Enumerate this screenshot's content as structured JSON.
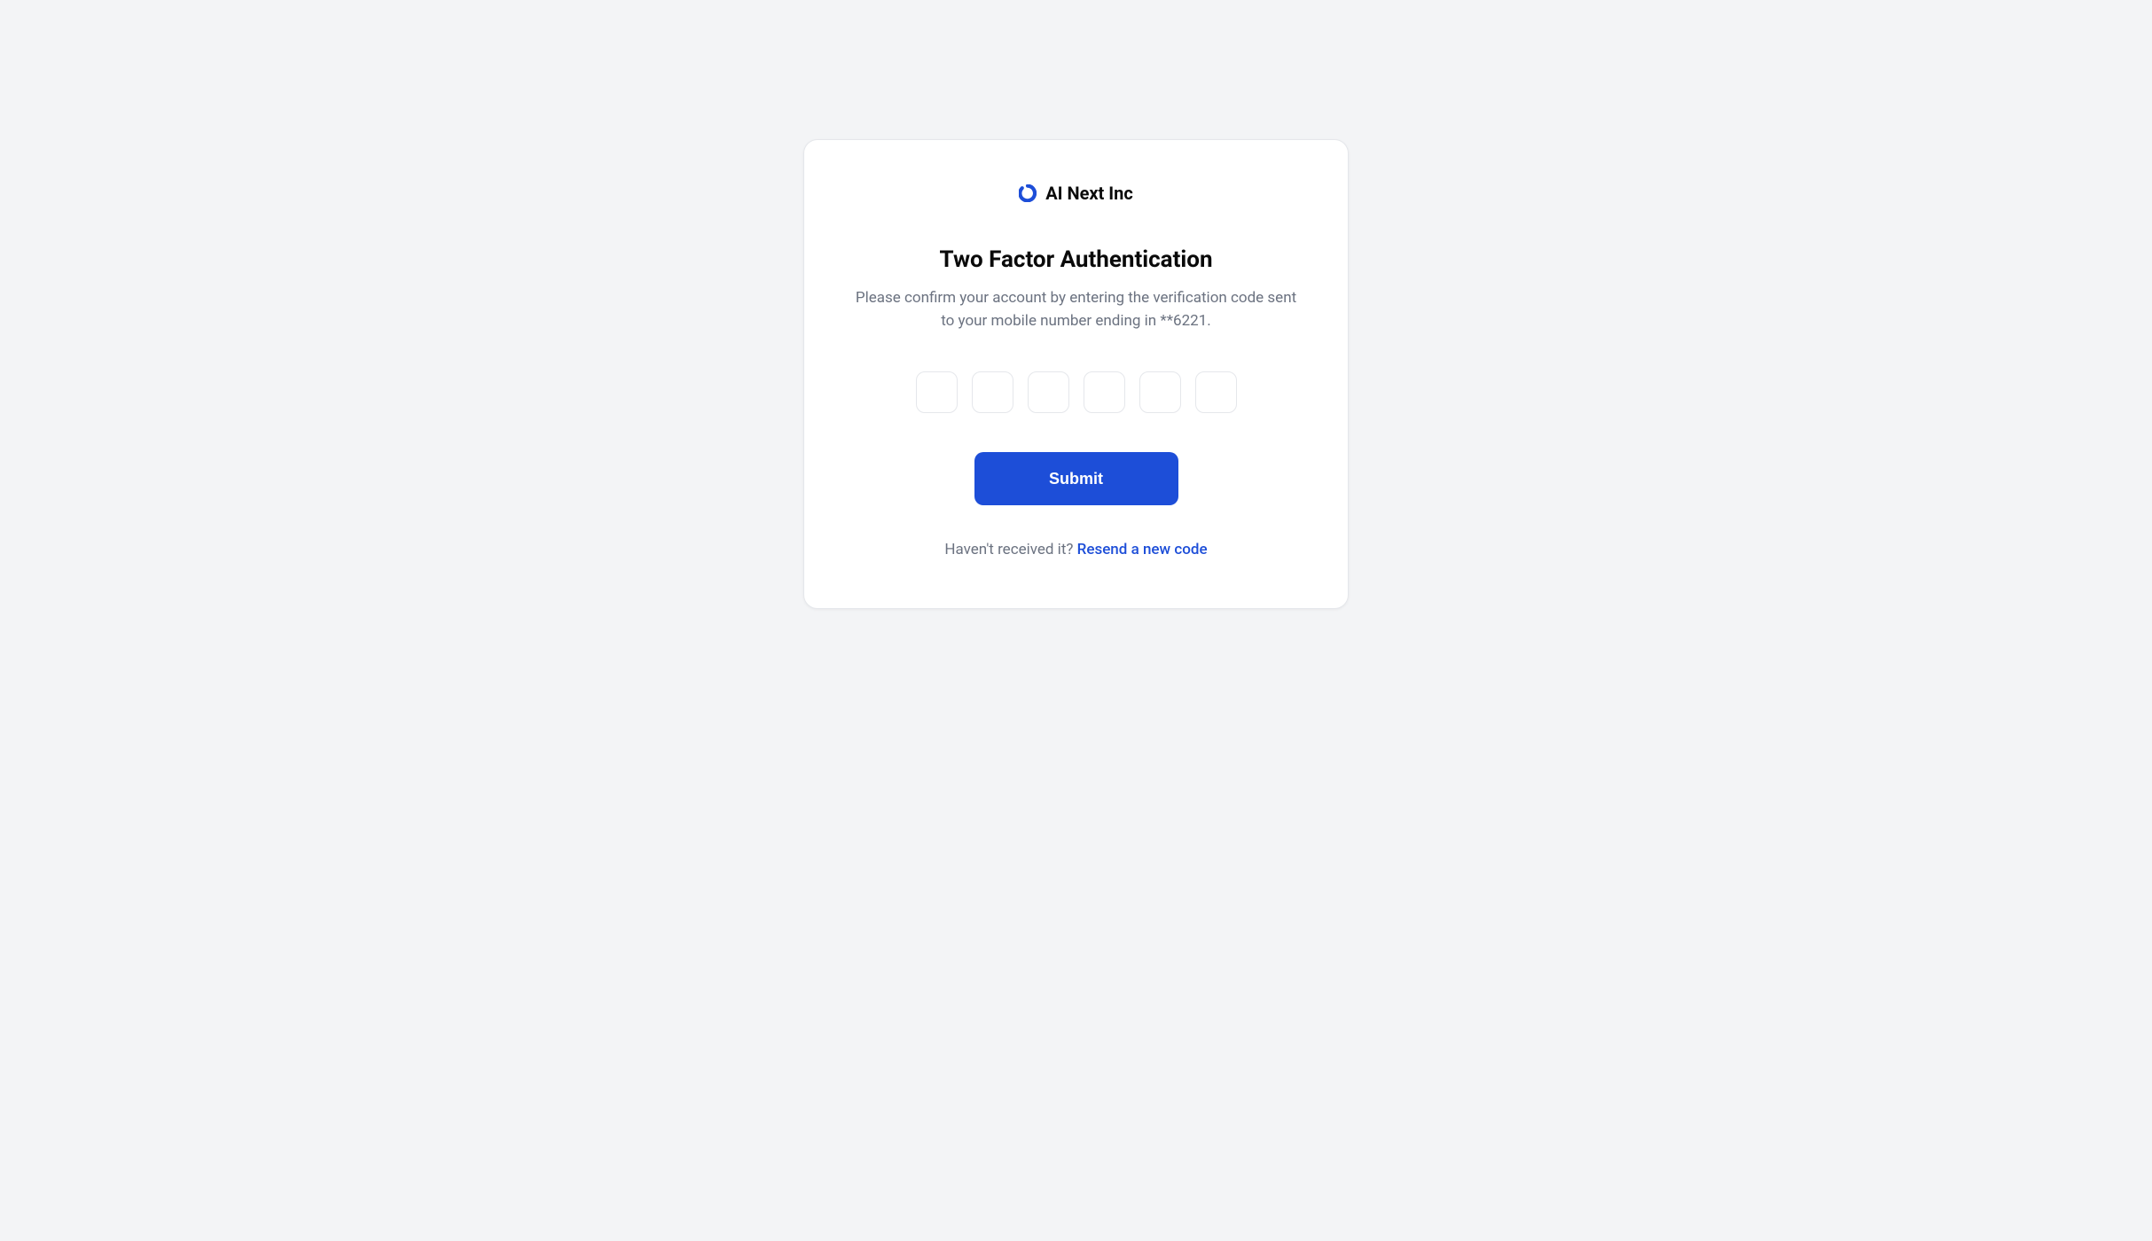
{
  "company": {
    "name": "AI Next Inc"
  },
  "heading": "Two Factor Authentication",
  "description": "Please confirm your account by entering the verification code sent to your mobile number ending in **6221.",
  "submit_label": "Submit",
  "resend": {
    "prompt": "Haven't received it? ",
    "link_text": "Resend a new code"
  }
}
